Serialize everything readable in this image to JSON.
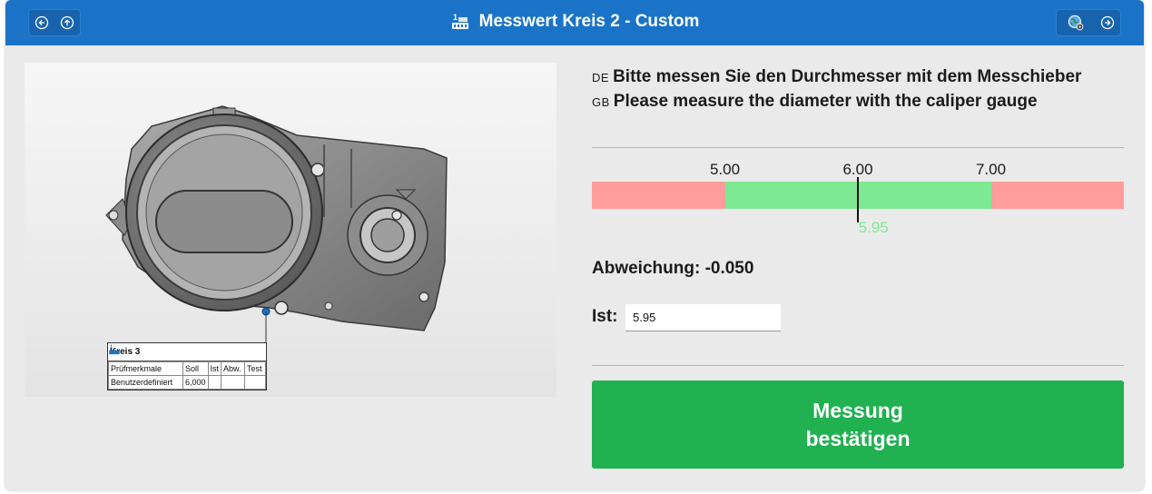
{
  "window": {
    "title": "Messwert Kreis 2 - Custom",
    "accent_color": "#1a73c7",
    "nav_left": [
      {
        "icon": "arrow-left-circle-icon"
      },
      {
        "icon": "arrow-up-circle-icon"
      }
    ],
    "nav_right": [
      {
        "icon": "globe-settings-icon"
      },
      {
        "icon": "arrow-right-circle-icon"
      }
    ]
  },
  "viewer": {
    "tag": {
      "title": "Kreis 3",
      "columns": [
        "Prüfmerkmale",
        "Soll",
        "Ist",
        "Abw.",
        "Test"
      ],
      "row": [
        "Benutzerdefiniert",
        "6,000",
        "",
        "",
        ""
      ]
    }
  },
  "instructions": [
    {
      "lang": "DE",
      "text": "Bitte messen Sie den Durchmesser mit dem Messchieber"
    },
    {
      "lang": "GB",
      "text": "Please measure the diameter with the caliper gauge"
    }
  ],
  "scale": {
    "lower": "5.00",
    "nominal": "6.00",
    "upper": "7.00",
    "measured": "5.95",
    "lower_value": 5.0,
    "upper_value": 7.0,
    "measured_value": 5.95,
    "range_min": 4.0,
    "range_max": 8.0,
    "colors": {
      "out_of_tolerance": "#ff9d9c",
      "in_tolerance": "#7de993"
    }
  },
  "deviation": {
    "label": "Abweichung:",
    "value": "-0.050"
  },
  "actual": {
    "label": "Ist:",
    "value": "5.95"
  },
  "confirm_button": {
    "line1": "Messung",
    "line2": "bestätigen",
    "color": "#21b151"
  }
}
